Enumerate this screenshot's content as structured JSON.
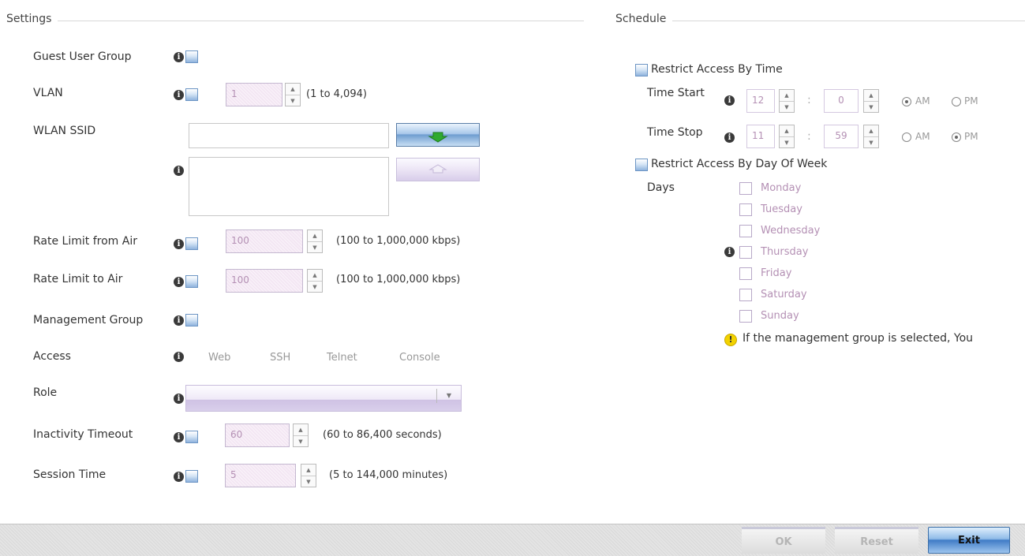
{
  "settings": {
    "title": "Settings",
    "guest_user_group": {
      "label": "Guest User Group"
    },
    "vlan": {
      "label": "VLAN",
      "value": "1",
      "hint": "(1 to 4,094)"
    },
    "wlan_ssid": {
      "label": "WLAN SSID",
      "input_value": ""
    },
    "rate_limit_from_air": {
      "label": "Rate Limit from Air",
      "value": "100",
      "hint": "(100 to 1,000,000 kbps)"
    },
    "rate_limit_to_air": {
      "label": "Rate Limit to Air",
      "value": "100",
      "hint": "(100 to 1,000,000 kbps)"
    },
    "management_group": {
      "label": "Management Group"
    },
    "access": {
      "label": "Access",
      "options": [
        "Web",
        "SSH",
        "Telnet",
        "Console"
      ]
    },
    "role": {
      "label": "Role",
      "value": ""
    },
    "inactivity_timeout": {
      "label": "Inactivity Timeout",
      "value": "60",
      "hint": "(60 to 86,400 seconds)"
    },
    "session_time": {
      "label": "Session Time",
      "value": "5",
      "hint": "(5 to 144,000 minutes)"
    }
  },
  "schedule": {
    "title": "Schedule",
    "restrict_by_time": {
      "label": "Restrict Access By Time"
    },
    "time_start": {
      "label": "Time Start",
      "hour": "12",
      "minute": "0",
      "am": "AM",
      "pm": "PM",
      "selected": "AM"
    },
    "time_stop": {
      "label": "Time Stop",
      "hour": "11",
      "minute": "59",
      "am": "AM",
      "pm": "PM",
      "selected": "PM"
    },
    "colon": ":",
    "restrict_by_day": {
      "label": "Restrict Access By Day Of Week"
    },
    "days": {
      "label": "Days",
      "items": [
        "Monday",
        "Tuesday",
        "Wednesday",
        "Thursday",
        "Friday",
        "Saturday",
        "Sunday"
      ]
    },
    "warning": "If the management group is selected, You"
  },
  "footer": {
    "ok_label": "OK",
    "reset_label": "Reset",
    "exit_label": "Exit"
  },
  "icons": {
    "info": "info-icon",
    "warning": "warning-icon",
    "add": "arrow-down-icon",
    "remove": "arrow-up-icon"
  },
  "colors": {
    "checkbox_blue": "#8fb3dd",
    "disabled_field": "#f3e6f3",
    "exit_button": "#3f7bc6",
    "warning_yellow": "#f2d200"
  }
}
